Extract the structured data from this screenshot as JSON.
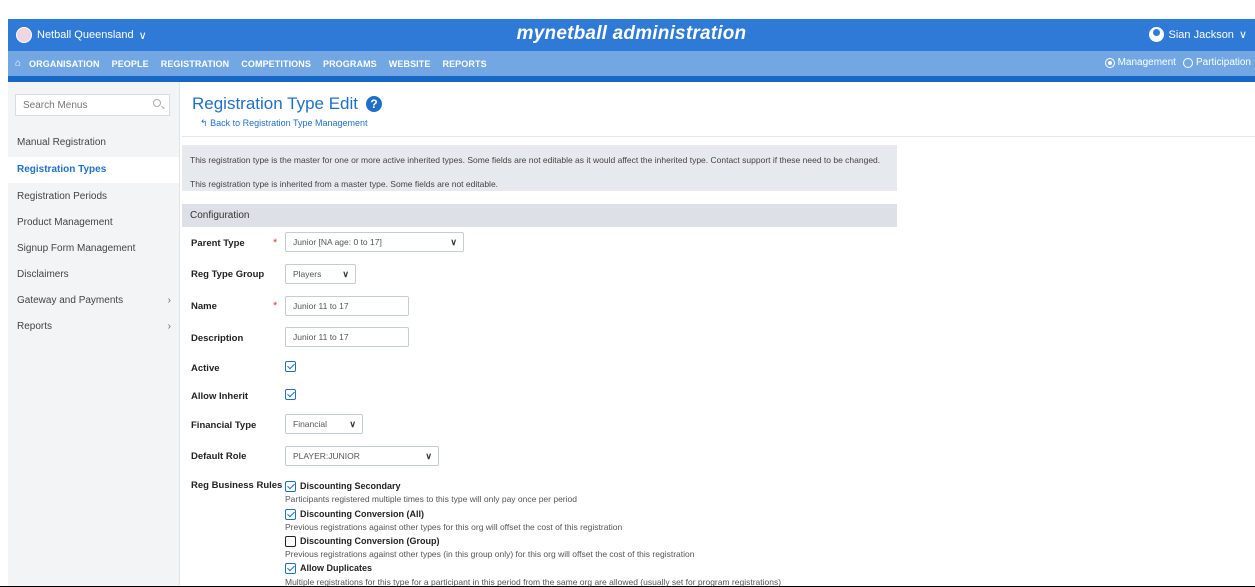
{
  "header": {
    "org_name": "Netball Queensland",
    "app_title": "mynetball administration",
    "user_name": "Sian Jackson"
  },
  "nav": {
    "items": [
      "ORGANISATION",
      "PEOPLE",
      "REGISTRATION",
      "COMPETITIONS",
      "PROGRAMS",
      "WEBSITE",
      "REPORTS"
    ],
    "mode_management": "Management",
    "mode_participation": "Participation"
  },
  "sidebar": {
    "search_placeholder": "Search Menus",
    "items": [
      {
        "label": "Manual Registration"
      },
      {
        "label": "Registration Types"
      },
      {
        "label": "Registration Periods"
      },
      {
        "label": "Product Management"
      },
      {
        "label": "Signup Form Management"
      },
      {
        "label": "Disclaimers"
      },
      {
        "label": "Gateway and Payments"
      },
      {
        "label": "Reports"
      }
    ]
  },
  "page": {
    "title": "Registration Type Edit",
    "back_link": "Back to Registration Type Management",
    "info_master": "This registration type is the master for one or more active inherited types. Some fields are not editable as it would affect the inherited type. Contact support if these need to be changed.",
    "info_inherited": "This registration type is inherited from a master type. Some fields are not editable.",
    "section_title": "Configuration"
  },
  "form": {
    "parent_type_label": "Parent Type",
    "parent_type_value": "Junior [NA age: 0 to 17]",
    "reg_type_group_label": "Reg Type Group",
    "reg_type_group_value": "Players",
    "name_label": "Name",
    "name_value": "Junior 11 to 17",
    "description_label": "Description",
    "description_value": "Junior 11 to 17",
    "active_label": "Active",
    "allow_inherit_label": "Allow Inherit",
    "financial_type_label": "Financial Type",
    "financial_type_value": "Financial",
    "default_role_label": "Default Role",
    "default_role_value": "PLAYER:JUNIOR",
    "business_rules_label": "Reg Business Rules",
    "rules": [
      {
        "title": "Discounting Secondary",
        "desc": "Participants registered multiple times to this type will only pay once per period",
        "checked": true
      },
      {
        "title": "Discounting Conversion (All)",
        "desc": "Previous registrations against other types for this org will offset the cost of this registration",
        "checked": true
      },
      {
        "title": "Discounting Conversion (Group)",
        "desc": "Previous registrations against other types (in this group only) for this org will offset the cost of this registration",
        "checked": false
      },
      {
        "title": "Allow Duplicates",
        "desc": "Multiple registrations for this type for a participant in this period from the same org are allowed (usually set for program registrations)",
        "checked": true
      }
    ]
  },
  "colors": {
    "brand_blue": "#2f7ad6",
    "nav_blue": "#72a7e3",
    "link_blue": "#1f6fc9",
    "required_red": "#e23d3d"
  }
}
